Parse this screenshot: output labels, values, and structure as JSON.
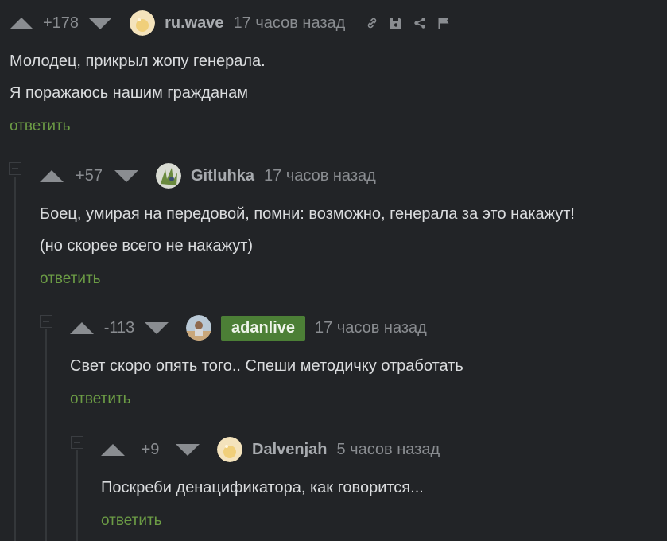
{
  "reply_label": "ответить",
  "comments": [
    {
      "rating": "+178",
      "username": "ru.wave",
      "time": "17 часов назад",
      "lines": [
        "Молодец, прикрыл жопу генерала.",
        "Я поражаюсь нашим гражданам"
      ],
      "tools": [
        "link-icon",
        "save-icon",
        "share-icon",
        "flag-icon"
      ]
    },
    {
      "rating": "+57",
      "username": "Gitluhka",
      "time": "17 часов назад",
      "lines": [
        "Боец, умирая на передовой, помни: возможно, генерала за это накажут!",
        "(но скорее всего не накажут)"
      ]
    },
    {
      "rating": "-113",
      "username": "adanlive",
      "time": "17 часов назад",
      "lines": [
        "Свет скоро опять того.. Спеши методичку отработать"
      ]
    },
    {
      "rating": "+9",
      "username": "Dalvenjah",
      "time": "5 часов назад",
      "lines": [
        "Поскреби денацификатора, как говорится..."
      ]
    }
  ],
  "colors": {
    "background": "#222427",
    "text": "#dadcde",
    "muted": "#8a8d91",
    "reply_link": "#6c9c45",
    "author_badge": "#4c7f36"
  }
}
